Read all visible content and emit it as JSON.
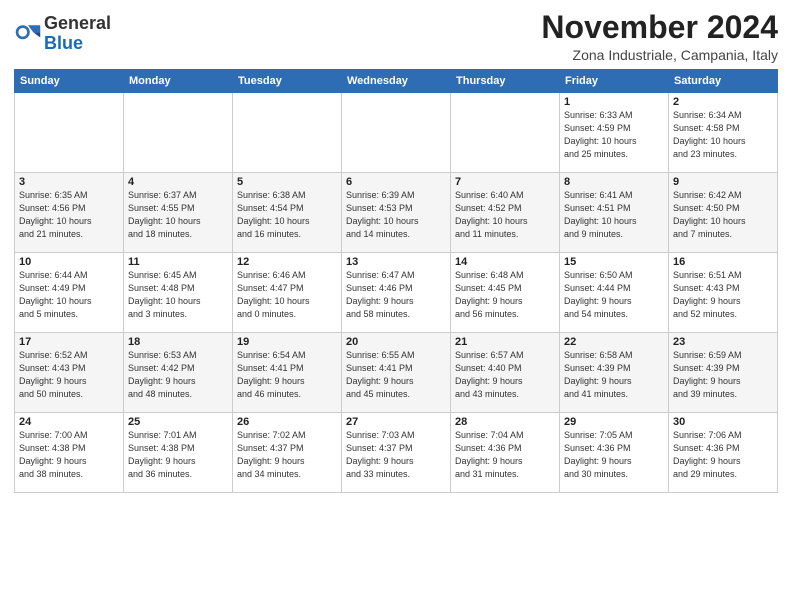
{
  "logo": {
    "general": "General",
    "blue": "Blue"
  },
  "header": {
    "title": "November 2024",
    "subtitle": "Zona Industriale, Campania, Italy"
  },
  "weekdays": [
    "Sunday",
    "Monday",
    "Tuesday",
    "Wednesday",
    "Thursday",
    "Friday",
    "Saturday"
  ],
  "weeks": [
    [
      {
        "day": "",
        "info": ""
      },
      {
        "day": "",
        "info": ""
      },
      {
        "day": "",
        "info": ""
      },
      {
        "day": "",
        "info": ""
      },
      {
        "day": "",
        "info": ""
      },
      {
        "day": "1",
        "info": "Sunrise: 6:33 AM\nSunset: 4:59 PM\nDaylight: 10 hours\nand 25 minutes."
      },
      {
        "day": "2",
        "info": "Sunrise: 6:34 AM\nSunset: 4:58 PM\nDaylight: 10 hours\nand 23 minutes."
      }
    ],
    [
      {
        "day": "3",
        "info": "Sunrise: 6:35 AM\nSunset: 4:56 PM\nDaylight: 10 hours\nand 21 minutes."
      },
      {
        "day": "4",
        "info": "Sunrise: 6:37 AM\nSunset: 4:55 PM\nDaylight: 10 hours\nand 18 minutes."
      },
      {
        "day": "5",
        "info": "Sunrise: 6:38 AM\nSunset: 4:54 PM\nDaylight: 10 hours\nand 16 minutes."
      },
      {
        "day": "6",
        "info": "Sunrise: 6:39 AM\nSunset: 4:53 PM\nDaylight: 10 hours\nand 14 minutes."
      },
      {
        "day": "7",
        "info": "Sunrise: 6:40 AM\nSunset: 4:52 PM\nDaylight: 10 hours\nand 11 minutes."
      },
      {
        "day": "8",
        "info": "Sunrise: 6:41 AM\nSunset: 4:51 PM\nDaylight: 10 hours\nand 9 minutes."
      },
      {
        "day": "9",
        "info": "Sunrise: 6:42 AM\nSunset: 4:50 PM\nDaylight: 10 hours\nand 7 minutes."
      }
    ],
    [
      {
        "day": "10",
        "info": "Sunrise: 6:44 AM\nSunset: 4:49 PM\nDaylight: 10 hours\nand 5 minutes."
      },
      {
        "day": "11",
        "info": "Sunrise: 6:45 AM\nSunset: 4:48 PM\nDaylight: 10 hours\nand 3 minutes."
      },
      {
        "day": "12",
        "info": "Sunrise: 6:46 AM\nSunset: 4:47 PM\nDaylight: 10 hours\nand 0 minutes."
      },
      {
        "day": "13",
        "info": "Sunrise: 6:47 AM\nSunset: 4:46 PM\nDaylight: 9 hours\nand 58 minutes."
      },
      {
        "day": "14",
        "info": "Sunrise: 6:48 AM\nSunset: 4:45 PM\nDaylight: 9 hours\nand 56 minutes."
      },
      {
        "day": "15",
        "info": "Sunrise: 6:50 AM\nSunset: 4:44 PM\nDaylight: 9 hours\nand 54 minutes."
      },
      {
        "day": "16",
        "info": "Sunrise: 6:51 AM\nSunset: 4:43 PM\nDaylight: 9 hours\nand 52 minutes."
      }
    ],
    [
      {
        "day": "17",
        "info": "Sunrise: 6:52 AM\nSunset: 4:43 PM\nDaylight: 9 hours\nand 50 minutes."
      },
      {
        "day": "18",
        "info": "Sunrise: 6:53 AM\nSunset: 4:42 PM\nDaylight: 9 hours\nand 48 minutes."
      },
      {
        "day": "19",
        "info": "Sunrise: 6:54 AM\nSunset: 4:41 PM\nDaylight: 9 hours\nand 46 minutes."
      },
      {
        "day": "20",
        "info": "Sunrise: 6:55 AM\nSunset: 4:41 PM\nDaylight: 9 hours\nand 45 minutes."
      },
      {
        "day": "21",
        "info": "Sunrise: 6:57 AM\nSunset: 4:40 PM\nDaylight: 9 hours\nand 43 minutes."
      },
      {
        "day": "22",
        "info": "Sunrise: 6:58 AM\nSunset: 4:39 PM\nDaylight: 9 hours\nand 41 minutes."
      },
      {
        "day": "23",
        "info": "Sunrise: 6:59 AM\nSunset: 4:39 PM\nDaylight: 9 hours\nand 39 minutes."
      }
    ],
    [
      {
        "day": "24",
        "info": "Sunrise: 7:00 AM\nSunset: 4:38 PM\nDaylight: 9 hours\nand 38 minutes."
      },
      {
        "day": "25",
        "info": "Sunrise: 7:01 AM\nSunset: 4:38 PM\nDaylight: 9 hours\nand 36 minutes."
      },
      {
        "day": "26",
        "info": "Sunrise: 7:02 AM\nSunset: 4:37 PM\nDaylight: 9 hours\nand 34 minutes."
      },
      {
        "day": "27",
        "info": "Sunrise: 7:03 AM\nSunset: 4:37 PM\nDaylight: 9 hours\nand 33 minutes."
      },
      {
        "day": "28",
        "info": "Sunrise: 7:04 AM\nSunset: 4:36 PM\nDaylight: 9 hours\nand 31 minutes."
      },
      {
        "day": "29",
        "info": "Sunrise: 7:05 AM\nSunset: 4:36 PM\nDaylight: 9 hours\nand 30 minutes."
      },
      {
        "day": "30",
        "info": "Sunrise: 7:06 AM\nSunset: 4:36 PM\nDaylight: 9 hours\nand 29 minutes."
      }
    ]
  ]
}
